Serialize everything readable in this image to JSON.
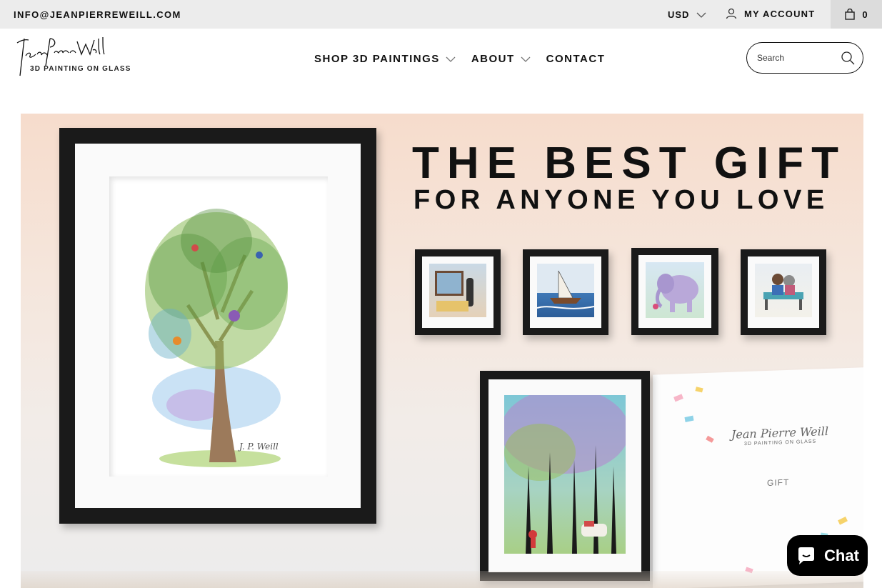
{
  "topbar": {
    "email": "INFO@JEANPIERREWEILL.COM",
    "currency": "USD",
    "account_label": "MY ACCOUNT",
    "cart_count": "0"
  },
  "logo": {
    "script_text": "Jean Pierre Weill",
    "tagline": "3D PAINTING ON GLASS"
  },
  "nav": {
    "items": [
      {
        "label": "SHOP 3D PAINTINGS",
        "has_dropdown": true
      },
      {
        "label": "ABOUT",
        "has_dropdown": true
      },
      {
        "label": "CONTACT",
        "has_dropdown": false
      }
    ]
  },
  "search": {
    "placeholder": "Search"
  },
  "hero": {
    "headline_line1": "THE BEST GIFT",
    "headline_line2": "FOR ANYONE YOU LOVE",
    "card_signature": "Jean Pierre Weill",
    "card_tagline": "3D PAINTING ON GLASS",
    "card_label": "GIFT"
  },
  "chat": {
    "label": "Chat"
  },
  "colors": {
    "topbar_bg": "#ececec",
    "text": "#111111",
    "chat_bg": "#000000"
  }
}
